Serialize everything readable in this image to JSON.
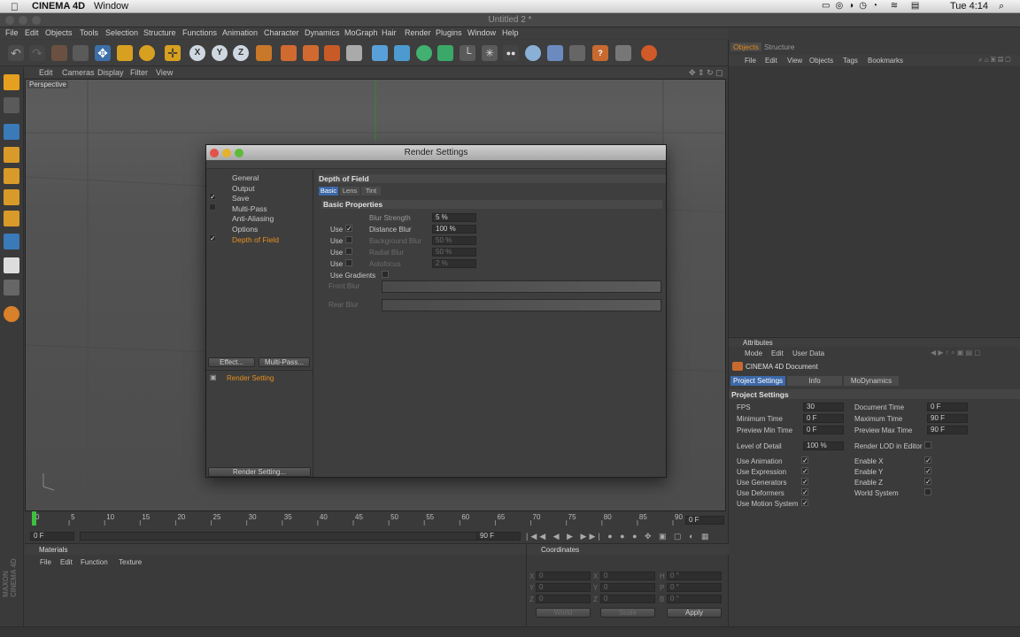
{
  "mac_menu": {
    "apple": "",
    "app": "CINEMA 4D",
    "window": "Window",
    "clock": "Tue 4:14"
  },
  "window_title": "Untitled 2 *",
  "main_menu": [
    "File",
    "Edit",
    "Objects",
    "Tools",
    "Selection",
    "Structure",
    "Functions",
    "Animation",
    "Character",
    "Dynamics",
    "MoGraph",
    "Hair",
    "Render",
    "Plugins",
    "Window",
    "Help"
  ],
  "viewport": {
    "menu": [
      "Edit",
      "Cameras",
      "Display",
      "Filter",
      "View"
    ],
    "label": "Perspective"
  },
  "objects_panel": {
    "tabs": [
      "Objects",
      "Structure"
    ],
    "menu": [
      "File",
      "Edit",
      "View",
      "Objects",
      "Tags",
      "Bookmarks"
    ]
  },
  "attributes": {
    "title": "Attributes",
    "menu": [
      "Mode",
      "Edit",
      "User Data"
    ],
    "doc_name": "CINEMA 4D Document",
    "tabs": [
      "Project Settings",
      "Info",
      "MoDynamics"
    ],
    "section": "Project Settings",
    "left_fields": [
      {
        "label": "FPS",
        "value": "30"
      },
      {
        "label": "Minimum Time",
        "value": "0 F"
      },
      {
        "label": "Preview Min Time",
        "value": "0 F"
      },
      {
        "label": "Level of Detail",
        "value": "100 %"
      }
    ],
    "right_fields": [
      {
        "label": "Document Time",
        "value": "0 F"
      },
      {
        "label": "Maximum Time",
        "value": "90 F"
      },
      {
        "label": "Preview Max Time",
        "value": "90 F"
      },
      {
        "label": "Render LOD in Editor",
        "value": ""
      }
    ],
    "left_checks": [
      {
        "label": "Use Animation",
        "checked": true
      },
      {
        "label": "Use Expression",
        "checked": true
      },
      {
        "label": "Use Generators",
        "checked": true
      },
      {
        "label": "Use Deformers",
        "checked": true
      },
      {
        "label": "Use Motion System",
        "checked": true
      }
    ],
    "right_checks": [
      {
        "label": "Enable X",
        "checked": true
      },
      {
        "label": "Enable Y",
        "checked": true
      },
      {
        "label": "Enable Z",
        "checked": true
      },
      {
        "label": "World System",
        "checked": false
      }
    ]
  },
  "render_settings": {
    "title": "Render Settings",
    "nav": [
      {
        "label": "General",
        "checked": false
      },
      {
        "label": "Output",
        "checked": false
      },
      {
        "label": "Save",
        "checked": true
      },
      {
        "label": "Multi-Pass",
        "checked": false
      },
      {
        "label": "Anti-Aliasing",
        "checked": false
      },
      {
        "label": "Options",
        "checked": false
      },
      {
        "label": "Depth of Field",
        "checked": true
      }
    ],
    "effect_button": "Effect...",
    "multipass_button": "Multi-Pass...",
    "setting_name": "Render Setting",
    "render_setting_button": "Render Setting...",
    "heading": "Depth of Field",
    "tabs": [
      "Basic",
      "Lens",
      "Tint"
    ],
    "section": "Basic Properties",
    "use_label": "Use",
    "params": [
      {
        "label": "Blur Strength",
        "value": "5 %"
      },
      {
        "label": "Distance Blur",
        "value": "100 %"
      },
      {
        "label": "Background Blur",
        "value": "50 %"
      },
      {
        "label": "Radial Blur",
        "value": "50 %"
      },
      {
        "label": "Autofocus",
        "value": "2 %"
      }
    ],
    "use_gradients": "Use Gradients",
    "front_blur": "Front Blur",
    "rear_blur": "Rear Blur"
  },
  "timeline": {
    "ticks": [
      "0",
      "5",
      "10",
      "15",
      "20",
      "25",
      "30",
      "35",
      "40",
      "45",
      "50",
      "55",
      "60",
      "65",
      "70",
      "75",
      "80",
      "85",
      "90"
    ],
    "frame": "0 F",
    "start": "0 F",
    "end_a": "90 F",
    "end_b": "90 F"
  },
  "materials": {
    "title": "Materials",
    "menu": [
      "File",
      "Edit",
      "Function",
      "Texture"
    ]
  },
  "coordinates": {
    "title": "Coordinates",
    "rows": [
      [
        "X",
        "0",
        "X",
        "0",
        "H",
        "0 °"
      ],
      [
        "Y",
        "0",
        "Y",
        "0",
        "P",
        "0 °"
      ],
      [
        "Z",
        "0",
        "Z",
        "0",
        "B",
        "0 °"
      ]
    ],
    "mode1": "World",
    "mode2": "Scale",
    "apply": "Apply"
  },
  "maxon_logo": "MAXON CINEMA 4D"
}
